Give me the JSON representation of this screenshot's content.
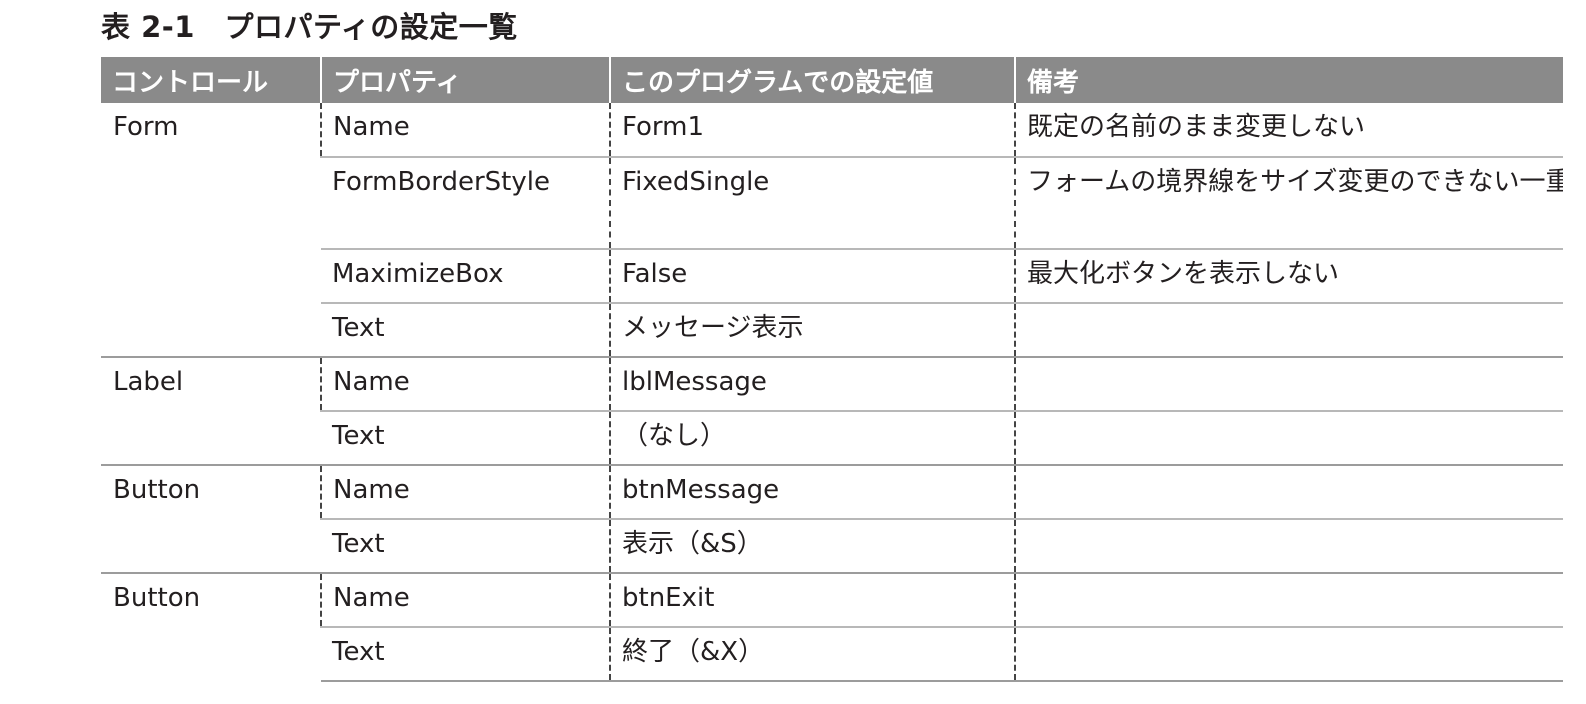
{
  "caption": "表 2-1　プロパティの設定一覧",
  "table": {
    "headers": [
      "コントロール",
      "プロパティ",
      "このプログラムでの設定値",
      "備考"
    ],
    "groups": [
      {
        "control": "Form",
        "rows": [
          {
            "property": "Name",
            "value": "Form1",
            "note": "既定の名前のまま変更しない"
          },
          {
            "property": "FormBorderStyle",
            "value": "FixedSingle",
            "note": "フォームの境界線をサイズ変更のできない一重の枠にする"
          },
          {
            "property": "MaximizeBox",
            "value": "False",
            "note": "最大化ボタンを表示しない"
          },
          {
            "property": "Text",
            "value": "メッセージ表示",
            "note": ""
          }
        ]
      },
      {
        "control": "Label",
        "rows": [
          {
            "property": "Name",
            "value": "lblMessage",
            "note": ""
          },
          {
            "property": "Text",
            "value": "（なし）",
            "note": ""
          }
        ]
      },
      {
        "control": "Button",
        "rows": [
          {
            "property": "Name",
            "value": "btnMessage",
            "note": ""
          },
          {
            "property": "Text",
            "value": "表示（&S）",
            "note": ""
          }
        ]
      },
      {
        "control": "Button",
        "rows": [
          {
            "property": "Name",
            "value": "btnExit",
            "note": ""
          },
          {
            "property": "Text",
            "value": "終了（&X）",
            "note": ""
          }
        ]
      }
    ]
  }
}
